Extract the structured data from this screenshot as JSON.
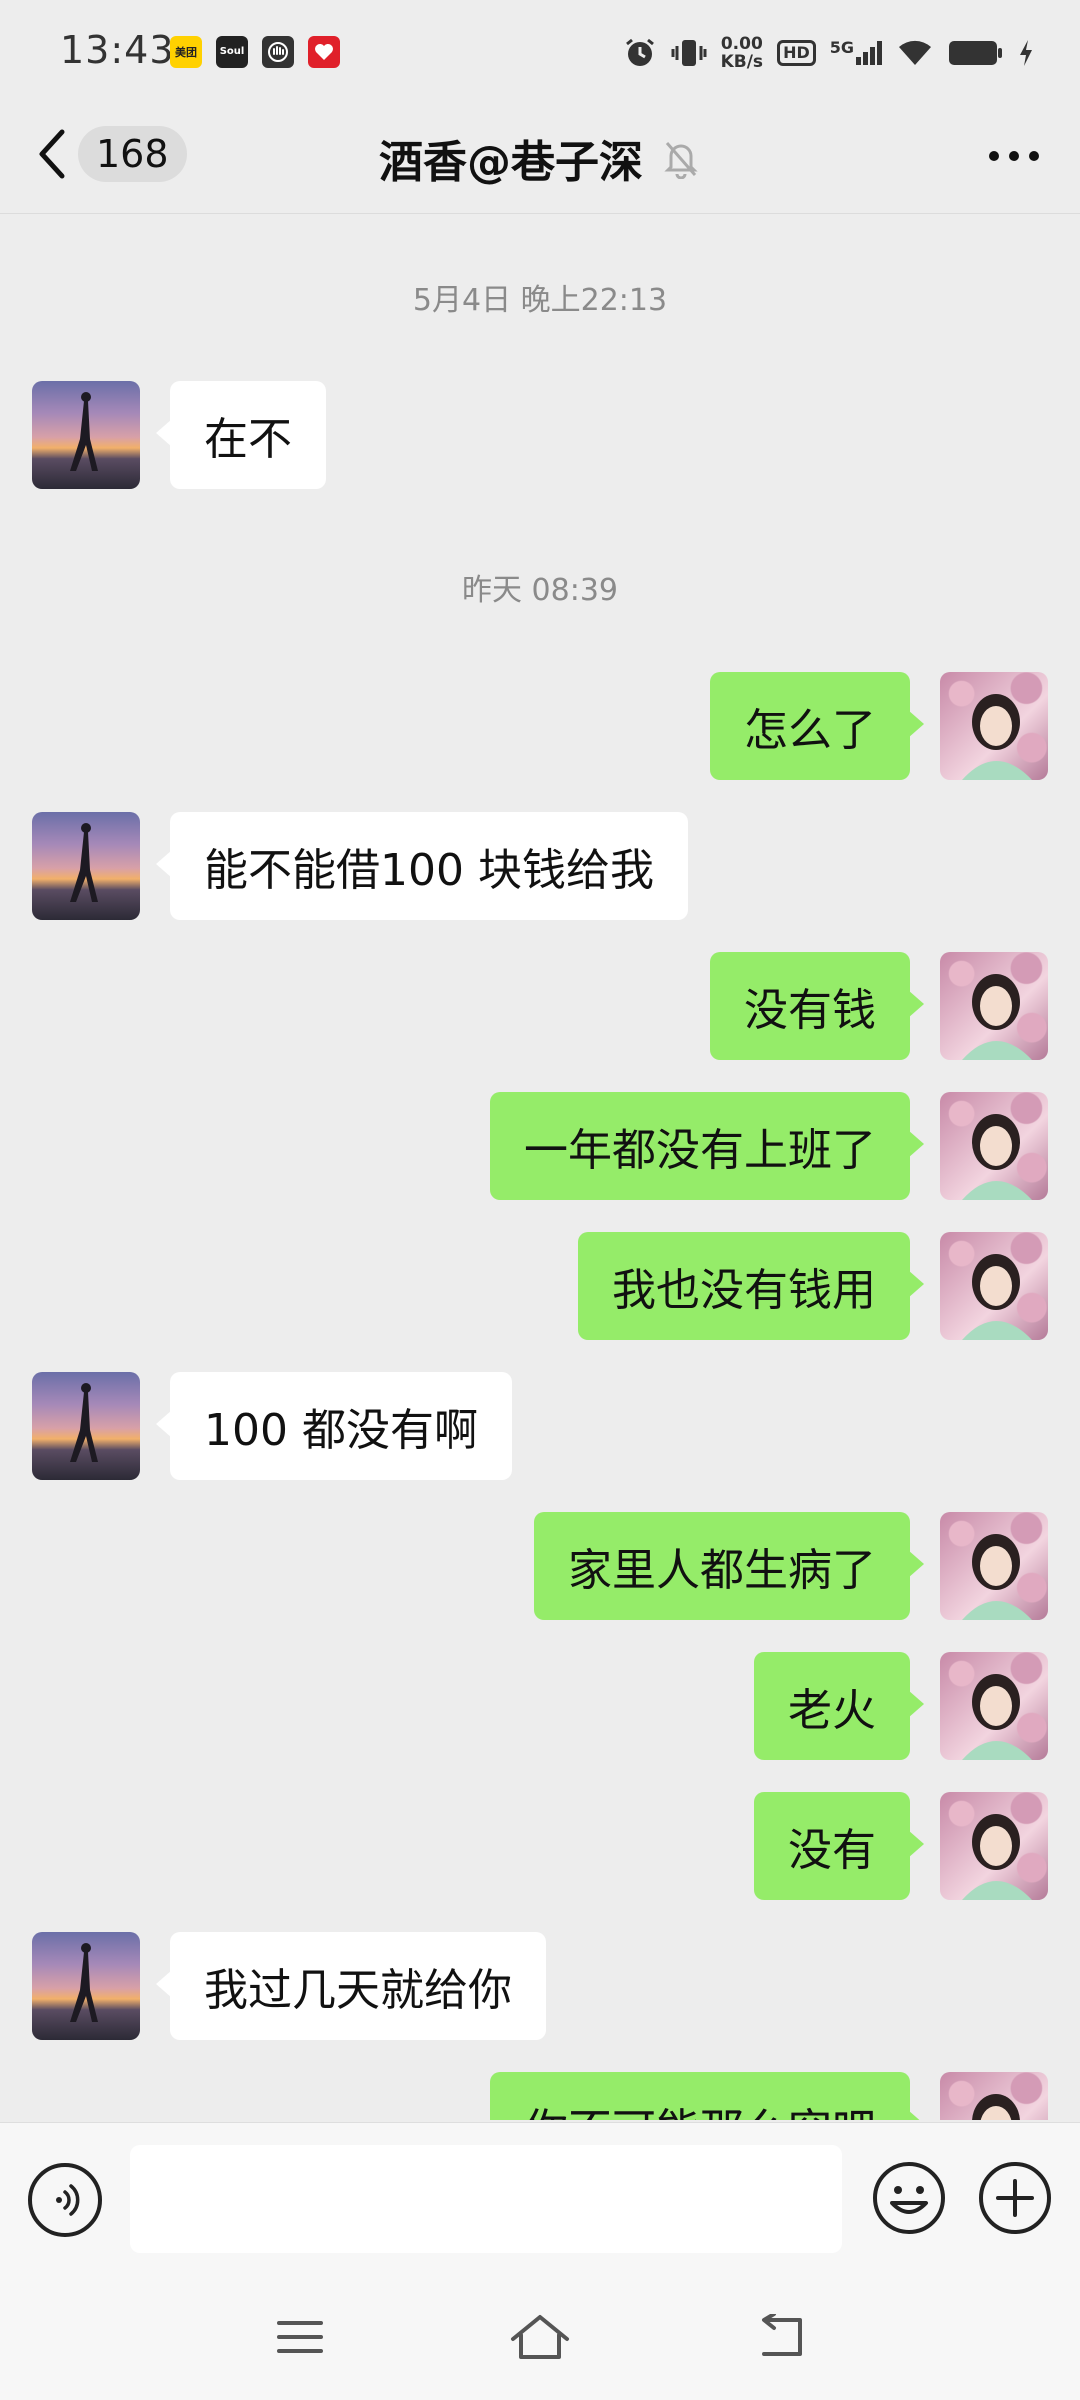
{
  "status_bar": {
    "time": "13:43",
    "notification_apps": [
      "美团",
      "Soul",
      "",
      ""
    ],
    "net_speed_value": "0.00",
    "net_speed_unit": "KB/s",
    "hd_label": "HD",
    "network_label": "5G"
  },
  "header": {
    "back_unread_count": "168",
    "title": "酒香@巷子深"
  },
  "chat": {
    "timestamps": [
      "5月4日 晚上22:13",
      "昨天 08:39"
    ],
    "messages": [
      {
        "side": "left",
        "text": "在不"
      },
      {
        "side": "right",
        "text": "怎么了"
      },
      {
        "side": "left",
        "text": "能不能借100 块钱给我"
      },
      {
        "side": "right",
        "text": "没有钱"
      },
      {
        "side": "right",
        "text": "一年都没有上班了"
      },
      {
        "side": "right",
        "text": "我也没有钱用"
      },
      {
        "side": "left",
        "text": "100 都没有啊"
      },
      {
        "side": "right",
        "text": "家里人都生病了"
      },
      {
        "side": "right",
        "text": "老火"
      },
      {
        "side": "right",
        "text": "没有"
      },
      {
        "side": "left",
        "text": "我过几天就给你"
      },
      {
        "side": "right",
        "text": "你不可能那么穷吧"
      }
    ]
  },
  "input_bar": {
    "text_value": ""
  },
  "colors": {
    "background": "#ededed",
    "bubble_self": "#95ec69",
    "bubble_other": "#ffffff",
    "timestamp_text": "#8a8a8a"
  },
  "icons": {
    "back": "chevron-left-icon",
    "mute": "bell-off-icon",
    "more": "more-dots-icon",
    "voice": "voice-icon",
    "emoji": "emoji-icon",
    "plus": "plus-icon",
    "nav_menu": "menu-icon",
    "nav_home": "home-icon",
    "nav_back": "back-icon"
  }
}
